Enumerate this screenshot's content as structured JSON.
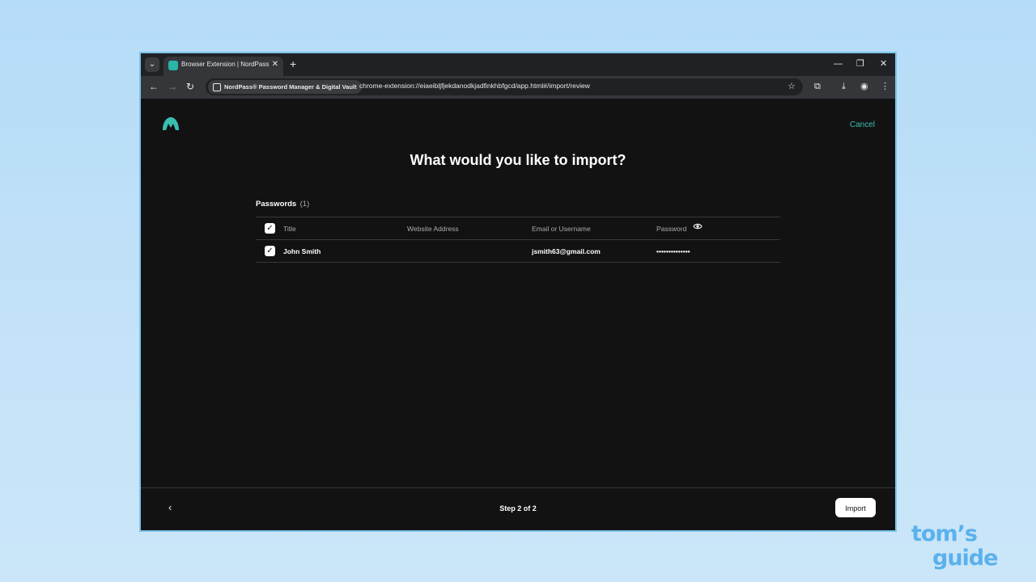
{
  "browser": {
    "tab_title": "Browser Extension | NordPass",
    "tab_close": "✕",
    "new_tab": "+",
    "tab_search_icon": "chevron-down-icon",
    "window_controls": {
      "minimize": "—",
      "restore": "❐",
      "close": "✕"
    },
    "site_chip": "NordPass® Password Manager & Digital Vault",
    "url": "chrome-extension://eiaeibljfjekdanodkjadfinkhbfgcd/app.html#/import/review"
  },
  "app": {
    "cancel_label": "Cancel",
    "heading": "What would you like to import?",
    "tabs": [
      {
        "label": "Passwords",
        "count": "(1)"
      }
    ],
    "table": {
      "headers": {
        "title": "Title",
        "website": "Website Address",
        "email": "Email or Username",
        "password": "Password"
      },
      "rows": [
        {
          "title": "John Smith",
          "website": "",
          "email": "jsmith63@gmail.com",
          "password": "••••••••••••••",
          "checked": true
        }
      ]
    },
    "footer": {
      "step": "Step 2 of 2",
      "import_label": "Import"
    }
  },
  "watermark": {
    "line1": "tom’s",
    "line2": "guide"
  },
  "colors": {
    "accent": "#3bbdb2",
    "background": "#121213",
    "page_bg": "#bfe0f8",
    "watermark": "#5ab1ec"
  }
}
